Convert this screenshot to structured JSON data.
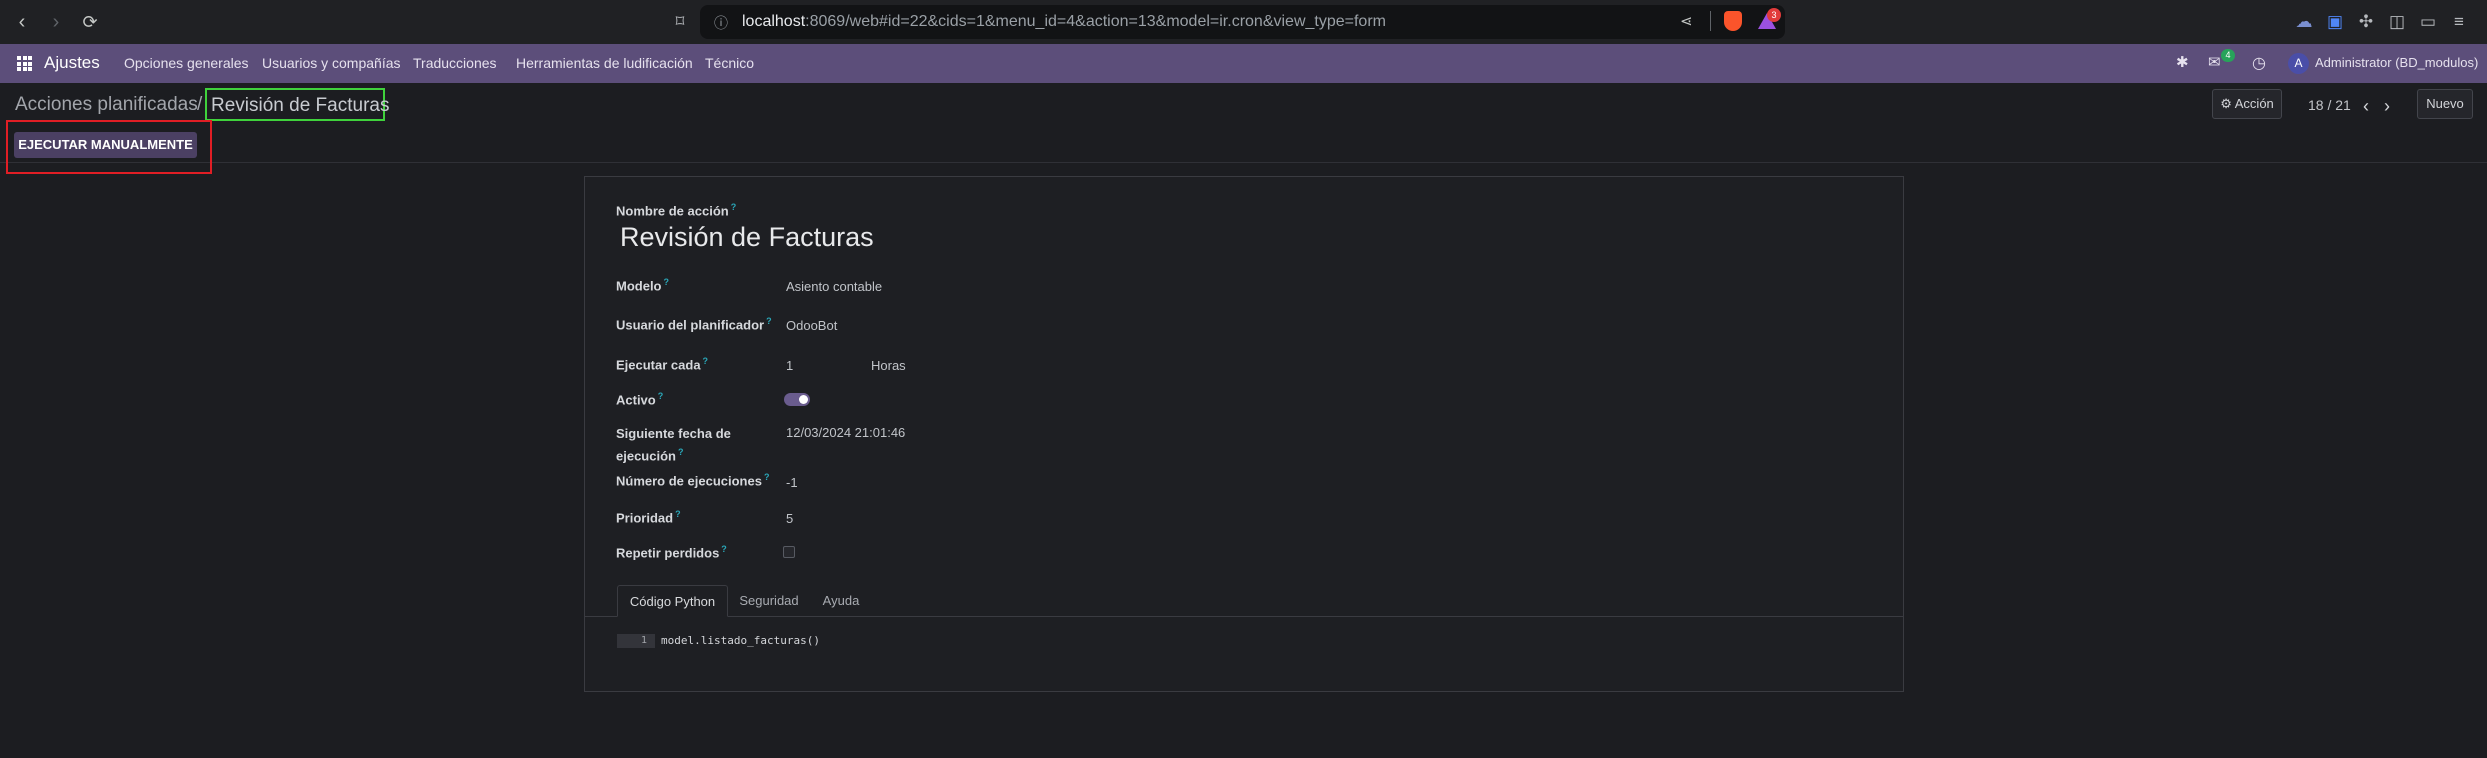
{
  "browser": {
    "url_host": "localhost",
    "url_rest": ":8069/web#id=22&cids=1&menu_id=4&action=13&model=ir.cron&view_type=form",
    "notification_badge": "3"
  },
  "navbar": {
    "app_name": "Ajustes",
    "menus": [
      "Opciones generales",
      "Usuarios y compañías",
      "Traducciones",
      "Herramientas de ludificación",
      "Técnico"
    ],
    "messages_count": "4",
    "user_initial": "A",
    "user_name": "Administrator (BD_modulos)"
  },
  "control": {
    "breadcrumb_parent": "Acciones planificadas",
    "breadcrumb_sep": "/",
    "breadcrumb_current": "Revisión de Facturas",
    "action_label": "Acción",
    "pager": "18 / 21",
    "new_label": "Nuevo",
    "run_manually_label": "EJECUTAR MANUALMENTE"
  },
  "form": {
    "name_label": "Nombre de acción",
    "name_value": "Revisión de Facturas",
    "model_label": "Modelo",
    "model_value": "Asiento contable",
    "user_label": "Usuario del planificador",
    "user_value": "OdooBot",
    "interval_label": "Ejecutar cada",
    "interval_number": "1",
    "interval_unit": "Horas",
    "active_label": "Activo",
    "active_value": true,
    "nextcall_label_1": "Siguiente fecha de",
    "nextcall_label_2": "ejecución",
    "nextcall_value": "12/03/2024 21:01:46",
    "numbercall_label": "Número de ejecuciones",
    "numbercall_value": "-1",
    "priority_label": "Prioridad",
    "priority_value": "5",
    "doall_label": "Repetir perdidos",
    "help_mark": "?"
  },
  "tabs": [
    "Código Python",
    "Seguridad",
    "Ayuda"
  ],
  "code": {
    "line_number": "1",
    "line": "model.listado_facturas()"
  },
  "colors": {
    "navbar": "#5c4e7a",
    "primary_button": "#4b4063",
    "highlight_green": "#3fd23c",
    "highlight_red": "#e01e25",
    "help_teal": "#2aa7b8"
  }
}
